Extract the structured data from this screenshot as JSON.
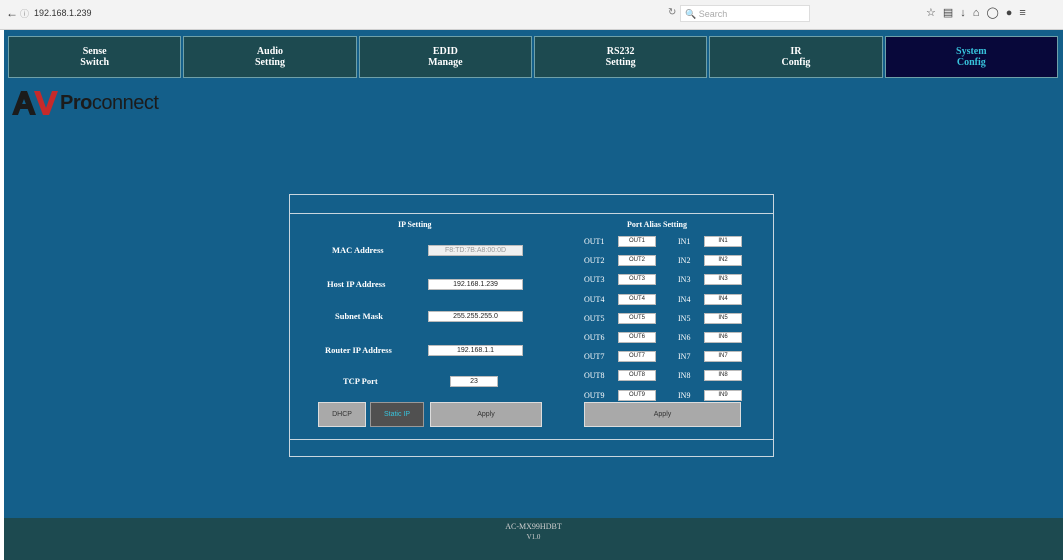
{
  "browser": {
    "url": "192.168.1.239",
    "search_placeholder": "Search"
  },
  "tabs": [
    {
      "line1": "Sense",
      "line2": "Switch"
    },
    {
      "line1": "Audio",
      "line2": "Setting"
    },
    {
      "line1": "EDID",
      "line2": "Manage"
    },
    {
      "line1": "RS232",
      "line2": "Setting"
    },
    {
      "line1": "IR",
      "line2": "Config"
    },
    {
      "line1": "System",
      "line2": "Config"
    }
  ],
  "logo": {
    "pro": "Pro",
    "connect": "connect"
  },
  "ip_setting": {
    "title": "IP Setting",
    "mac_label": "MAC Address",
    "mac_value": "F8:TD:7B:A8:00:0D",
    "host_label": "Host IP Address",
    "host_value": "192.168.1.239",
    "subnet_label": "Subnet Mask",
    "subnet_value": "255.255.255.0",
    "router_label": "Router IP Address",
    "router_value": "192.168.1.1",
    "tcp_label": "TCP Port",
    "tcp_value": "23",
    "dhcp_button": "DHCP",
    "static_button": "Static IP",
    "apply_button": "Apply"
  },
  "port_alias": {
    "title": "Port Alias Setting",
    "rows": [
      {
        "out_label": "OUT1",
        "out_value": "OUT1",
        "in_label": "IN1",
        "in_value": "IN1"
      },
      {
        "out_label": "OUT2",
        "out_value": "OUT2",
        "in_label": "IN2",
        "in_value": "IN2"
      },
      {
        "out_label": "OUT3",
        "out_value": "OUT3",
        "in_label": "IN3",
        "in_value": "IN3"
      },
      {
        "out_label": "OUT4",
        "out_value": "OUT4",
        "in_label": "IN4",
        "in_value": "IN4"
      },
      {
        "out_label": "OUT5",
        "out_value": "OUT5",
        "in_label": "IN5",
        "in_value": "IN5"
      },
      {
        "out_label": "OUT6",
        "out_value": "OUT6",
        "in_label": "IN6",
        "in_value": "IN6"
      },
      {
        "out_label": "OUT7",
        "out_value": "OUT7",
        "in_label": "IN7",
        "in_value": "IN7"
      },
      {
        "out_label": "OUT8",
        "out_value": "OUT8",
        "in_label": "IN8",
        "in_value": "IN8"
      },
      {
        "out_label": "OUT9",
        "out_value": "OUT9",
        "in_label": "IN9",
        "in_value": "IN9"
      }
    ],
    "apply_button": "Apply"
  },
  "footer": {
    "model": "AC-MX99HDBT",
    "version": "V1.0"
  },
  "colors": {
    "page_bg": "#145f8a",
    "tab_bg": "#1d4a50",
    "tab_active_bg": "#08083a",
    "tab_active_text": "#37c3dc"
  }
}
